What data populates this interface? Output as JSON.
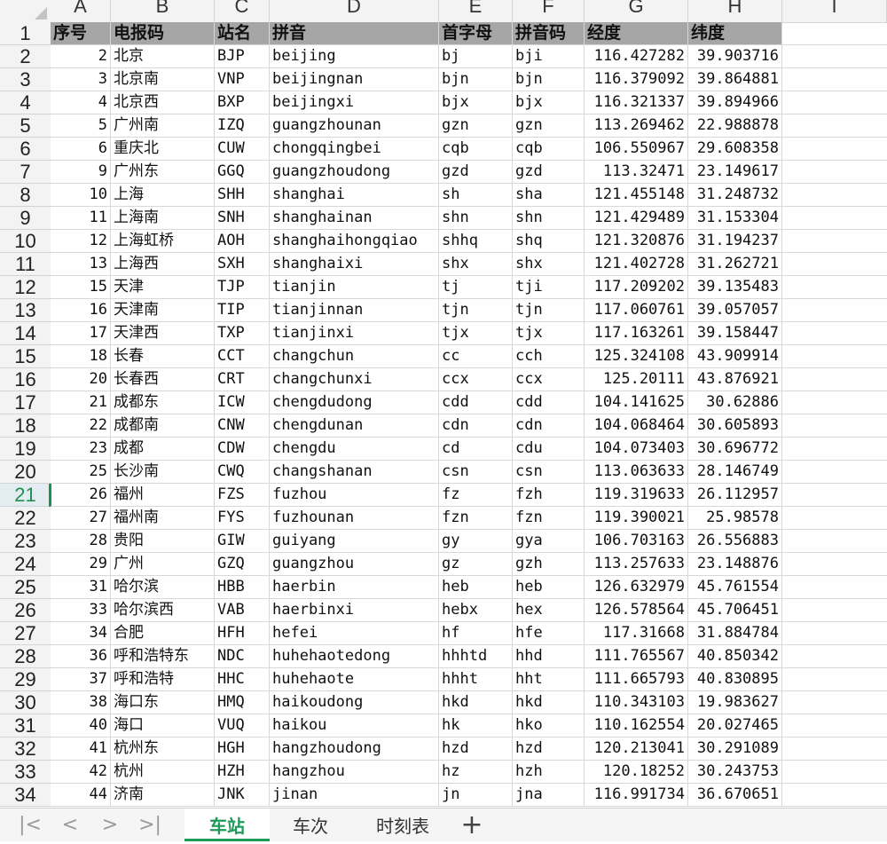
{
  "columns": [
    "A",
    "B",
    "C",
    "D",
    "E",
    "F",
    "G",
    "H",
    "I"
  ],
  "selected_row": "21",
  "header": [
    "序号",
    "电报码",
    "站名",
    "拼音",
    "首字母",
    "拼音码",
    "经度",
    "纬度"
  ],
  "rows": [
    [
      "2",
      "北京",
      "BJP",
      "beijing",
      "bj",
      "bji",
      "116.427282",
      "39.903716"
    ],
    [
      "3",
      "北京南",
      "VNP",
      "beijingnan",
      "bjn",
      "bjn",
      "116.379092",
      "39.864881"
    ],
    [
      "4",
      "北京西",
      "BXP",
      "beijingxi",
      "bjx",
      "bjx",
      "116.321337",
      "39.894966"
    ],
    [
      "5",
      "广州南",
      "IZQ",
      "guangzhounan",
      "gzn",
      "gzn",
      "113.269462",
      "22.988878"
    ],
    [
      "6",
      "重庆北",
      "CUW",
      "chongqingbei",
      "cqb",
      "cqb",
      "106.550967",
      "29.608358"
    ],
    [
      "9",
      "广州东",
      "GGQ",
      "guangzhoudong",
      "gzd",
      "gzd",
      "113.32471",
      "23.149617"
    ],
    [
      "10",
      "上海",
      "SHH",
      "shanghai",
      "sh",
      "sha",
      "121.455148",
      "31.248732"
    ],
    [
      "11",
      "上海南",
      "SNH",
      "shanghainan",
      "shn",
      "shn",
      "121.429489",
      "31.153304"
    ],
    [
      "12",
      "上海虹桥",
      "AOH",
      "shanghaihongqiao",
      "shhq",
      "shq",
      "121.320876",
      "31.194237"
    ],
    [
      "13",
      "上海西",
      "SXH",
      "shanghaixi",
      "shx",
      "shx",
      "121.402728",
      "31.262721"
    ],
    [
      "15",
      "天津",
      "TJP",
      "tianjin",
      "tj",
      "tji",
      "117.209202",
      "39.135483"
    ],
    [
      "16",
      "天津南",
      "TIP",
      "tianjinnan",
      "tjn",
      "tjn",
      "117.060761",
      "39.057057"
    ],
    [
      "17",
      "天津西",
      "TXP",
      "tianjinxi",
      "tjx",
      "tjx",
      "117.163261",
      "39.158447"
    ],
    [
      "18",
      "长春",
      "CCT",
      "changchun",
      "cc",
      "cch",
      "125.324108",
      "43.909914"
    ],
    [
      "20",
      "长春西",
      "CRT",
      "changchunxi",
      "ccx",
      "ccx",
      "125.20111",
      "43.876921"
    ],
    [
      "21",
      "成都东",
      "ICW",
      "chengdudong",
      "cdd",
      "cdd",
      "104.141625",
      "30.62886"
    ],
    [
      "22",
      "成都南",
      "CNW",
      "chengdunan",
      "cdn",
      "cdn",
      "104.068464",
      "30.605893"
    ],
    [
      "23",
      "成都",
      "CDW",
      "chengdu",
      "cd",
      "cdu",
      "104.073403",
      "30.696772"
    ],
    [
      "25",
      "长沙南",
      "CWQ",
      "changshanan",
      "csn",
      "csn",
      "113.063633",
      "28.146749"
    ],
    [
      "26",
      "福州",
      "FZS",
      "fuzhou",
      "fz",
      "fzh",
      "119.319633",
      "26.112957"
    ],
    [
      "27",
      "福州南",
      "FYS",
      "fuzhounan",
      "fzn",
      "fzn",
      "119.390021",
      "25.98578"
    ],
    [
      "28",
      "贵阳",
      "GIW",
      "guiyang",
      "gy",
      "gya",
      "106.703163",
      "26.556883"
    ],
    [
      "29",
      "广州",
      "GZQ",
      "guangzhou",
      "gz",
      "gzh",
      "113.257633",
      "23.148876"
    ],
    [
      "31",
      "哈尔滨",
      "HBB",
      "haerbin",
      "heb",
      "heb",
      "126.632979",
      "45.761554"
    ],
    [
      "33",
      "哈尔滨西",
      "VAB",
      "haerbinxi",
      "hebx",
      "hex",
      "126.578564",
      "45.706451"
    ],
    [
      "34",
      "合肥",
      "HFH",
      "hefei",
      "hf",
      "hfe",
      "117.31668",
      "31.884784"
    ],
    [
      "36",
      "呼和浩特东",
      "NDC",
      "huhehaotedong",
      "hhhtd",
      "hhd",
      "111.765567",
      "40.850342"
    ],
    [
      "37",
      "呼和浩特",
      "HHC",
      "huhehaote",
      "hhht",
      "hht",
      "111.665793",
      "40.830895"
    ],
    [
      "38",
      "海口东",
      "HMQ",
      "haikoudong",
      "hkd",
      "hkd",
      "110.343103",
      "19.983627"
    ],
    [
      "40",
      "海口",
      "VUQ",
      "haikou",
      "hk",
      "hko",
      "110.162554",
      "20.027465"
    ],
    [
      "41",
      "杭州东",
      "HGH",
      "hangzhoudong",
      "hzd",
      "hzd",
      "120.213041",
      "30.291089"
    ],
    [
      "42",
      "杭州",
      "HZH",
      "hangzhou",
      "hz",
      "hzh",
      "120.18252",
      "30.243753"
    ],
    [
      "44",
      "济南",
      "JNK",
      "jinan",
      "jn",
      "jna",
      "116.991734",
      "36.670651"
    ]
  ],
  "tabs": {
    "nav": [
      "|<",
      "<",
      ">",
      ">|"
    ],
    "sheets": [
      "车站",
      "车次",
      "时刻表"
    ],
    "active": "车站",
    "add": "+"
  }
}
